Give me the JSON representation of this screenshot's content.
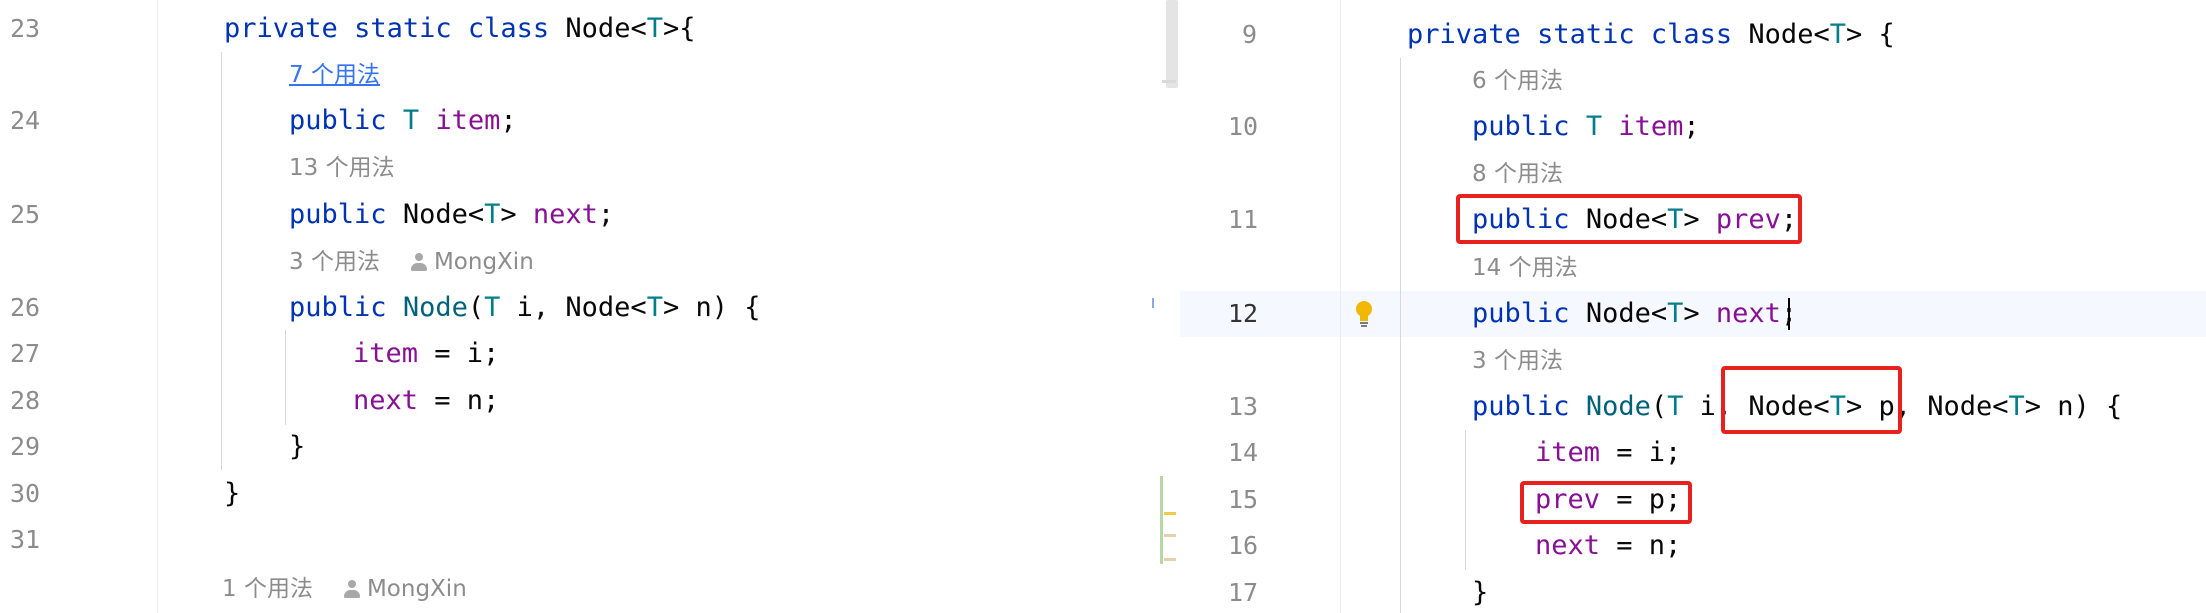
{
  "colors": {
    "keyword": "#0033b3",
    "type_param": "#007e8a",
    "field": "#871094",
    "method": "#00627a",
    "line_number": "#8c8c8c",
    "hint_link": "#3574f0",
    "highlight_box": "#e8201e",
    "current_line": "#f5f8fe"
  },
  "left": {
    "line_numbers": [
      "23",
      "24",
      "25",
      "26",
      "27",
      "28",
      "29",
      "30",
      "31"
    ],
    "code": {
      "l23": {
        "kw1": "private",
        "kw2": "static",
        "kw3": "class",
        "name": "Node<",
        "tp": "T",
        "rest": ">{"
      },
      "l24": {
        "kw": "public",
        "tp": "T",
        "field": "item",
        "rest": ";"
      },
      "l25": {
        "kw": "public",
        "type": "Node<",
        "tp": "T",
        "type2": ">",
        "field": "next",
        "rest": ";"
      },
      "l26": {
        "kw": "public",
        "method": "Node",
        "p1": "(",
        "tp1": "T",
        "p2": " i, Node<",
        "tp2": "T",
        "p3": "> n) {"
      },
      "l27": {
        "field": "item",
        "rest": " = i;"
      },
      "l28": {
        "field": "next",
        "rest": " = n;"
      },
      "l29": {
        "rest": "}"
      },
      "l30": {
        "rest": "}"
      }
    },
    "hints": {
      "item_usages": "7 个用法",
      "next_usages": "13 个用法",
      "ctor_usages": "3 个用法",
      "ctor_author": "MongXin",
      "class_usages": "1 个用法",
      "class_author": "MongXin"
    }
  },
  "right": {
    "line_numbers": [
      "9",
      "10",
      "11",
      "12",
      "13",
      "14",
      "15",
      "16",
      "17"
    ],
    "code": {
      "l9": {
        "kw1": "private",
        "kw2": "static",
        "kw3": "class",
        "name": "Node<",
        "tp": "T",
        "rest": "> {"
      },
      "l10": {
        "kw": "public",
        "tp": "T",
        "field": "item",
        "rest": ";"
      },
      "l11": {
        "kw": "public",
        "type": "Node<",
        "tp": "T",
        "type2": ">",
        "field": "prev",
        "rest": ";"
      },
      "l12": {
        "kw": "public",
        "type": "Node<",
        "tp": "T",
        "type2": ">",
        "field": "next",
        "rest": ";"
      },
      "l13": {
        "kw": "public",
        "method": "Node",
        "p1": "(",
        "tp1": "T",
        "p2": " i, Node<",
        "tp2": "T",
        "p3": "> p, Node<",
        "tp3": "T",
        "p4": "> n) {"
      },
      "l14": {
        "field": "item",
        "rest": " = i;"
      },
      "l15": {
        "field": "prev",
        "rest": " = p;"
      },
      "l16": {
        "field": "next",
        "rest": " = n;"
      },
      "l17": {
        "rest": "}"
      }
    },
    "hints": {
      "item_usages": "6 个用法",
      "prev_usages": "8 个用法",
      "next_usages": "14 个用法",
      "ctor_usages": "3 个用法"
    }
  },
  "icons": {
    "bulb": "lightbulb-icon",
    "author": "person-icon"
  }
}
